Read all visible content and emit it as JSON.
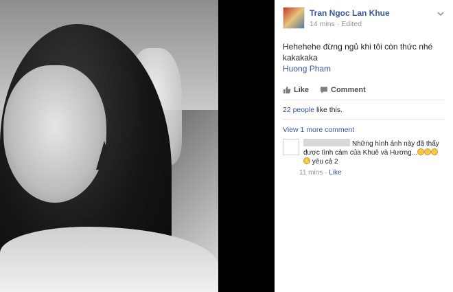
{
  "post": {
    "author": "Tran Ngoc Lan Khue",
    "time": "14 mins",
    "separator": "·",
    "edited": "Edited",
    "text": "Hehehehe đừng ngủ khi tôi còn thức nhé kakakaka",
    "mention": "Huong Pham"
  },
  "actions": {
    "like": "Like",
    "comment": "Comment"
  },
  "likes": {
    "count_link": "22 people",
    "suffix": " like this."
  },
  "comments": {
    "view_more": "View 1 more comment",
    "items": [
      {
        "text_before": "Những hình ảnh này đã thấy được tình cảm của Khuê và Hương...",
        "text_after": " yêu cả 2",
        "emoji_count": 4,
        "time": "11 mins",
        "separator": "·",
        "like": "Like"
      }
    ]
  },
  "icons": {
    "like": "thumbs-up-icon",
    "comment": "speech-bubble-icon",
    "menu": "chevron-down-icon"
  },
  "colors": {
    "link": "#365899",
    "muted": "#90949c",
    "photo_backdrop": "#000000"
  }
}
